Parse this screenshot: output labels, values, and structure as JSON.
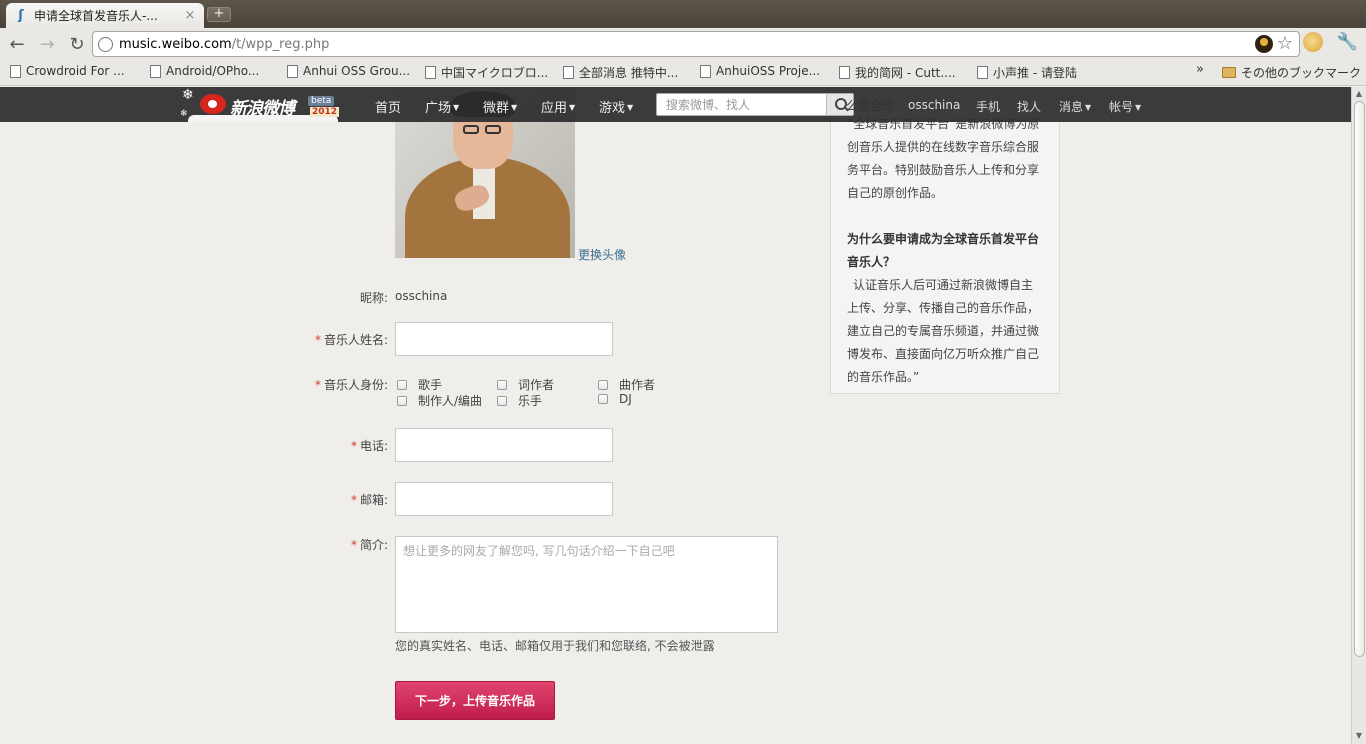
{
  "browser": {
    "tab_title": "申请全球首发音乐人-...",
    "tab_close": "×",
    "new_tab": "+",
    "url_host": "music.weibo.com",
    "url_path": "/t/wpp_reg.php",
    "bookmarks": [
      "Crowdroid For ...",
      "Android/OPho...",
      "Anhui OSS Grou...",
      "中国マイクロブロ...",
      "全部消息 推特中...",
      "AnhuiOSS Proje...",
      "我的简网 - Cutt....",
      "小声推 - 请登陆"
    ],
    "bookmarks_more": "»",
    "other_bookmarks": "その他のブックマーク"
  },
  "weibo_nav": {
    "logo_text": "新浪微博",
    "logo_beta": "beta",
    "logo_year": "2012",
    "items": [
      "首页",
      "广场",
      "微群",
      "应用",
      "游戏"
    ],
    "search_placeholder": "搜索微博、找人",
    "user_name": "osschina",
    "right_items": [
      "手机",
      "找人",
      "消息",
      "帐号"
    ],
    "partial_heading": "么是全球"
  },
  "profile": {
    "change_avatar": "更换头像",
    "nickname_label": "昵称:",
    "nickname_value": "osschina"
  },
  "form": {
    "required_mark": "*",
    "name_label": "音乐人姓名:",
    "identity_label": "音乐人身份:",
    "identity_options": [
      "歌手",
      "词作者",
      "曲作者",
      "制作人/编曲",
      "乐手",
      "DJ"
    ],
    "phone_label": "电话:",
    "email_label": "邮箱:",
    "bio_label": "简介:",
    "bio_placeholder": "想让更多的网友了解您吗, 写几句话介绍一下自己吧",
    "privacy_note": "您的真实姓名、电话、邮箱仅用于我们和您联络, 不会被泄露",
    "next_button": "下一步，上传音乐作品"
  },
  "info": {
    "intro": "“全球音乐首发平台”是新浪微博为原创音乐人提供的在线数字音乐综合服务平台。特别鼓励音乐人上传和分享自己的原创作品。",
    "question": "为什么要申请成为全球音乐首发平台音乐人？",
    "answer": "认证音乐人后可通过新浪微博自主上传、分享、传播自己的音乐作品，建立自己的专属音乐频道，并通过微博发布、直接面向亿万听众推广自己的音乐作品。”"
  }
}
